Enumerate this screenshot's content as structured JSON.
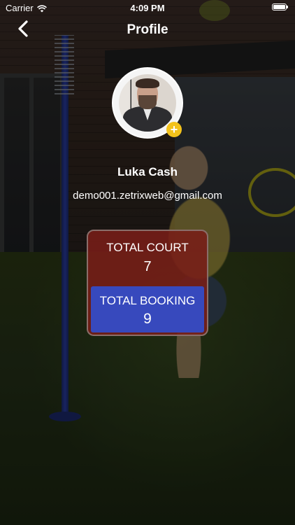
{
  "status_bar": {
    "carrier": "Carrier",
    "time": "4:09 PM",
    "wifi_icon": "wifi-icon",
    "battery_icon": "battery-full-icon"
  },
  "nav": {
    "title": "Profile",
    "back_icon": "chevron-left-icon"
  },
  "profile": {
    "name": "Luka Cash",
    "email": "demo001.zetrixweb@gmail.com",
    "add_photo_label": "+"
  },
  "stats": {
    "court": {
      "label": "TOTAL COURT",
      "value": "7"
    },
    "booking": {
      "label": "TOTAL BOOKING",
      "value": "9"
    }
  },
  "colors": {
    "accent_yellow": "#f3c21b",
    "court_card": "#7a1e18",
    "booking_card": "#3749bd"
  }
}
